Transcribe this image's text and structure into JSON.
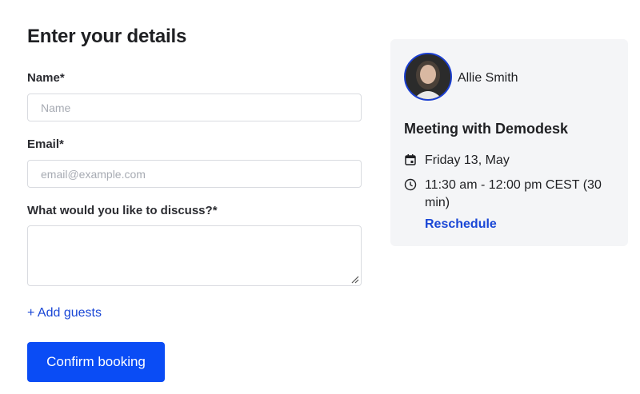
{
  "form": {
    "title": "Enter your details",
    "name": {
      "label": "Name",
      "required_mark": "*",
      "placeholder": "Name",
      "value": ""
    },
    "email": {
      "label": "Email",
      "required_mark": "*",
      "placeholder": "email@example.com",
      "value": ""
    },
    "discuss": {
      "label": "What would you like to discuss?",
      "required_mark": "*",
      "value": ""
    },
    "add_guests_label": "+ Add guests",
    "confirm_label": "Confirm booking"
  },
  "card": {
    "host_name": "Allie Smith",
    "meeting_title": "Meeting with Demodesk",
    "date": "Friday 13, May",
    "time": "11:30 am - 12:00 pm CEST (30 min)",
    "reschedule_label": "Reschedule",
    "date_icon": "calendar-icon",
    "time_icon": "clock-icon"
  },
  "colors": {
    "accent": "#0a4cf5",
    "link": "#1a47d6",
    "card_bg": "#f4f5f7",
    "avatar_border": "#1b3fd1"
  }
}
